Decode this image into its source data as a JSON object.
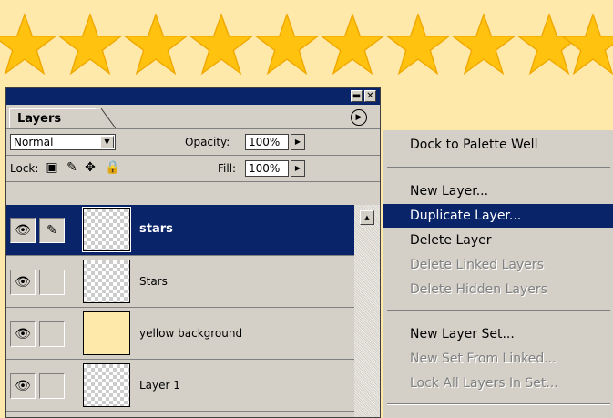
{
  "colors": {
    "star": "#ffc20e",
    "star_edge": "#f0a800",
    "background": "#ffe9aa",
    "selection": "#0a246a",
    "panel": "#d4d0c8"
  },
  "palette": {
    "tab_label": "Layers",
    "blend_mode": "Normal",
    "opacity_label": "Opacity:",
    "opacity_value": "100%",
    "lock_label": "Lock:",
    "fill_label": "Fill:",
    "fill_value": "100%",
    "layers": [
      {
        "name": "stars",
        "selected": true,
        "thumb": "transparent"
      },
      {
        "name": "Stars",
        "selected": false,
        "thumb": "transparent"
      },
      {
        "name": "yellow background",
        "selected": false,
        "thumb": "yellow"
      },
      {
        "name": "Layer 1",
        "selected": false,
        "thumb": "transparent"
      }
    ]
  },
  "menu": {
    "items": [
      {
        "label": "Dock to Palette Well",
        "state": "normal"
      },
      {
        "label": "New Layer...",
        "state": "normal"
      },
      {
        "label": "Duplicate Layer...",
        "state": "selected"
      },
      {
        "label": "Delete Layer",
        "state": "normal"
      },
      {
        "label": "Delete Linked Layers",
        "state": "disabled"
      },
      {
        "label": "Delete Hidden Layers",
        "state": "disabled"
      },
      {
        "label": "New Layer Set...",
        "state": "normal"
      },
      {
        "label": "New Set From Linked...",
        "state": "disabled"
      },
      {
        "label": "Lock All Layers In Set...",
        "state": "disabled"
      }
    ]
  }
}
